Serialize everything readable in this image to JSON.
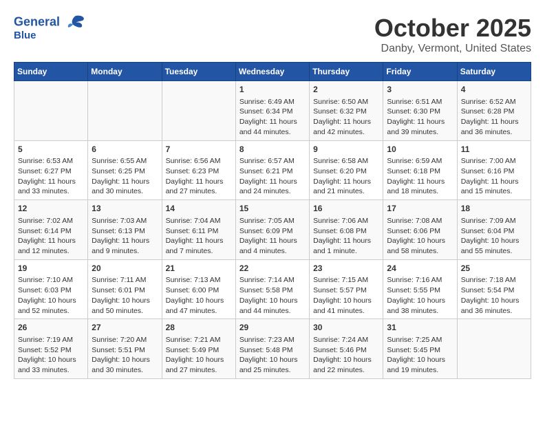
{
  "header": {
    "logo_line1": "General",
    "logo_line2": "Blue",
    "month_title": "October 2025",
    "location": "Danby, Vermont, United States"
  },
  "weekdays": [
    "Sunday",
    "Monday",
    "Tuesday",
    "Wednesday",
    "Thursday",
    "Friday",
    "Saturday"
  ],
  "weeks": [
    [
      {
        "day": "",
        "info": ""
      },
      {
        "day": "",
        "info": ""
      },
      {
        "day": "",
        "info": ""
      },
      {
        "day": "1",
        "info": "Sunrise: 6:49 AM\nSunset: 6:34 PM\nDaylight: 11 hours and 44 minutes."
      },
      {
        "day": "2",
        "info": "Sunrise: 6:50 AM\nSunset: 6:32 PM\nDaylight: 11 hours and 42 minutes."
      },
      {
        "day": "3",
        "info": "Sunrise: 6:51 AM\nSunset: 6:30 PM\nDaylight: 11 hours and 39 minutes."
      },
      {
        "day": "4",
        "info": "Sunrise: 6:52 AM\nSunset: 6:28 PM\nDaylight: 11 hours and 36 minutes."
      }
    ],
    [
      {
        "day": "5",
        "info": "Sunrise: 6:53 AM\nSunset: 6:27 PM\nDaylight: 11 hours and 33 minutes."
      },
      {
        "day": "6",
        "info": "Sunrise: 6:55 AM\nSunset: 6:25 PM\nDaylight: 11 hours and 30 minutes."
      },
      {
        "day": "7",
        "info": "Sunrise: 6:56 AM\nSunset: 6:23 PM\nDaylight: 11 hours and 27 minutes."
      },
      {
        "day": "8",
        "info": "Sunrise: 6:57 AM\nSunset: 6:21 PM\nDaylight: 11 hours and 24 minutes."
      },
      {
        "day": "9",
        "info": "Sunrise: 6:58 AM\nSunset: 6:20 PM\nDaylight: 11 hours and 21 minutes."
      },
      {
        "day": "10",
        "info": "Sunrise: 6:59 AM\nSunset: 6:18 PM\nDaylight: 11 hours and 18 minutes."
      },
      {
        "day": "11",
        "info": "Sunrise: 7:00 AM\nSunset: 6:16 PM\nDaylight: 11 hours and 15 minutes."
      }
    ],
    [
      {
        "day": "12",
        "info": "Sunrise: 7:02 AM\nSunset: 6:14 PM\nDaylight: 11 hours and 12 minutes."
      },
      {
        "day": "13",
        "info": "Sunrise: 7:03 AM\nSunset: 6:13 PM\nDaylight: 11 hours and 9 minutes."
      },
      {
        "day": "14",
        "info": "Sunrise: 7:04 AM\nSunset: 6:11 PM\nDaylight: 11 hours and 7 minutes."
      },
      {
        "day": "15",
        "info": "Sunrise: 7:05 AM\nSunset: 6:09 PM\nDaylight: 11 hours and 4 minutes."
      },
      {
        "day": "16",
        "info": "Sunrise: 7:06 AM\nSunset: 6:08 PM\nDaylight: 11 hours and 1 minute."
      },
      {
        "day": "17",
        "info": "Sunrise: 7:08 AM\nSunset: 6:06 PM\nDaylight: 10 hours and 58 minutes."
      },
      {
        "day": "18",
        "info": "Sunrise: 7:09 AM\nSunset: 6:04 PM\nDaylight: 10 hours and 55 minutes."
      }
    ],
    [
      {
        "day": "19",
        "info": "Sunrise: 7:10 AM\nSunset: 6:03 PM\nDaylight: 10 hours and 52 minutes."
      },
      {
        "day": "20",
        "info": "Sunrise: 7:11 AM\nSunset: 6:01 PM\nDaylight: 10 hours and 50 minutes."
      },
      {
        "day": "21",
        "info": "Sunrise: 7:13 AM\nSunset: 6:00 PM\nDaylight: 10 hours and 47 minutes."
      },
      {
        "day": "22",
        "info": "Sunrise: 7:14 AM\nSunset: 5:58 PM\nDaylight: 10 hours and 44 minutes."
      },
      {
        "day": "23",
        "info": "Sunrise: 7:15 AM\nSunset: 5:57 PM\nDaylight: 10 hours and 41 minutes."
      },
      {
        "day": "24",
        "info": "Sunrise: 7:16 AM\nSunset: 5:55 PM\nDaylight: 10 hours and 38 minutes."
      },
      {
        "day": "25",
        "info": "Sunrise: 7:18 AM\nSunset: 5:54 PM\nDaylight: 10 hours and 36 minutes."
      }
    ],
    [
      {
        "day": "26",
        "info": "Sunrise: 7:19 AM\nSunset: 5:52 PM\nDaylight: 10 hours and 33 minutes."
      },
      {
        "day": "27",
        "info": "Sunrise: 7:20 AM\nSunset: 5:51 PM\nDaylight: 10 hours and 30 minutes."
      },
      {
        "day": "28",
        "info": "Sunrise: 7:21 AM\nSunset: 5:49 PM\nDaylight: 10 hours and 27 minutes."
      },
      {
        "day": "29",
        "info": "Sunrise: 7:23 AM\nSunset: 5:48 PM\nDaylight: 10 hours and 25 minutes."
      },
      {
        "day": "30",
        "info": "Sunrise: 7:24 AM\nSunset: 5:46 PM\nDaylight: 10 hours and 22 minutes."
      },
      {
        "day": "31",
        "info": "Sunrise: 7:25 AM\nSunset: 5:45 PM\nDaylight: 10 hours and 19 minutes."
      },
      {
        "day": "",
        "info": ""
      }
    ]
  ]
}
